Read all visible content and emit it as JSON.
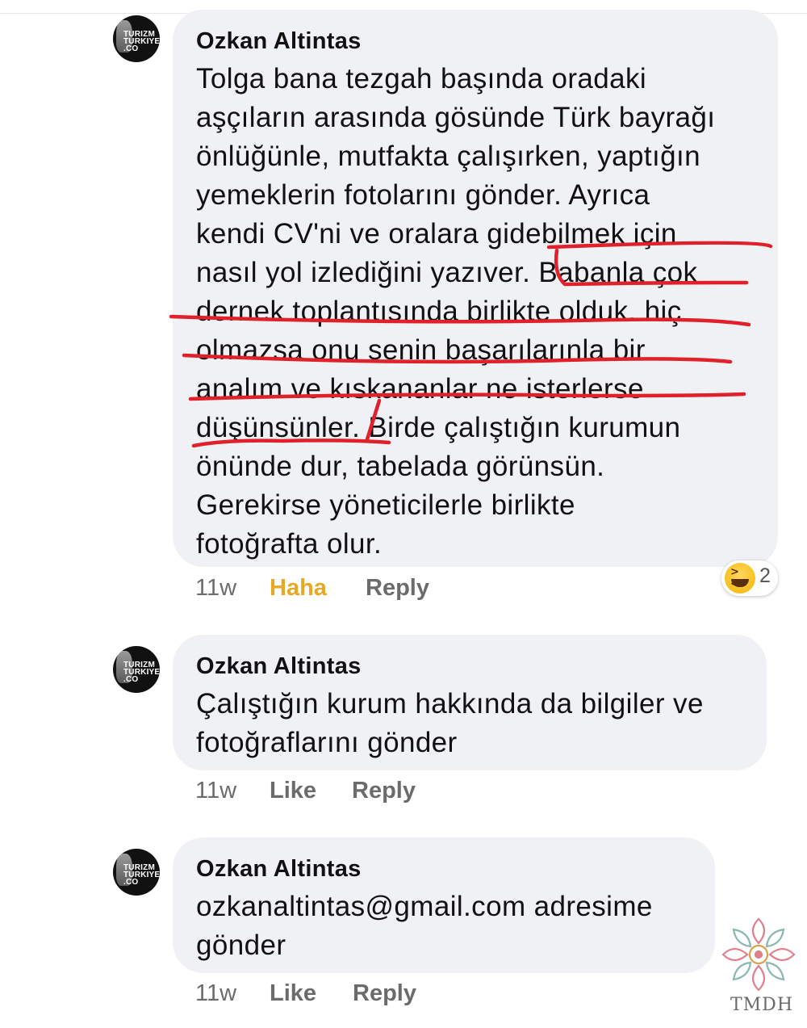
{
  "avatar_logo_text": "TURIZM TURKIYE .CO",
  "comments": [
    {
      "author": "Ozkan Altintas",
      "lines": [
        "Tolga bana tezgah başında oradaki",
        "aşçıların arasında gösünde Türk bayrağı",
        "önlüğünle, mutfakta çalışırken, yaptığın",
        "yemeklerin fotolarını gönder. Ayrıca",
        "kendi CV'ni ve oralara gidebilmek için",
        "nasıl yol izlediğini yazıver. Babanla çok",
        "dernek toplantısında birlikte olduk. hiç",
        "olmazsa onu senin başarılarınla bir",
        "analım ve kıskananlar ne isterlerse",
        "düşünsünler. Birde çalıştığın kurumun",
        "önünde dur, tabelada görünsün.",
        "Gerekirse yöneticilerle birlikte",
        "fotoğrafta olur."
      ],
      "time": "11w",
      "reaction_label": "Haha",
      "reply_label": "Reply",
      "reaction_count": "2",
      "reaction_icon": "laughing-emoji-icon"
    },
    {
      "author": "Ozkan Altintas",
      "lines": [
        "Çalıştığın kurum hakkında da bilgiler ve",
        "fotoğraflarını gönder"
      ],
      "time": "11w",
      "like_label": "Like",
      "reply_label": "Reply"
    },
    {
      "author": "Ozkan Altintas",
      "lines": [
        "ozkanaltintas@gmail.com adresime",
        "gönder"
      ],
      "time": "11w",
      "like_label": "Like",
      "reply_label": "Reply"
    }
  ],
  "annotation_color": "#e0202a",
  "haha_color": "#e7a824",
  "watermark_text": "TMDH"
}
